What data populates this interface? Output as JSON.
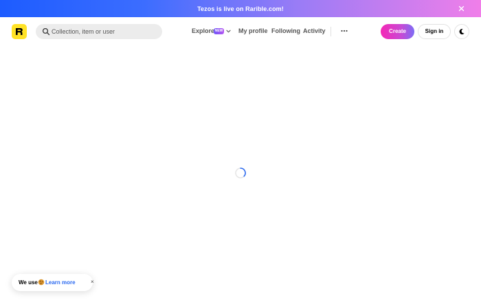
{
  "banner": {
    "text": "Tezos is live on Rarible.com!",
    "close_icon": "close-icon"
  },
  "header": {
    "logo_icon": "rarible-logo",
    "search": {
      "placeholder": "Collection, item or user",
      "icon": "search-icon"
    },
    "nav": {
      "explore": "Explore",
      "explore_badge": "NEW",
      "my_profile": "My profile",
      "following": "Following",
      "activity": "Activity",
      "more_icon": "more-icon"
    },
    "create_label": "Create",
    "sign_in_label": "Sign in",
    "theme_icon": "moon-icon"
  },
  "cookie": {
    "text": "We use",
    "emoji_icon": "cookie-icon",
    "link": "Learn more",
    "close": "×"
  },
  "colors": {
    "banner_gradient": [
      "#1d5cff",
      "#9a7cf6",
      "#f07ee9"
    ],
    "logo_bg": "#ffe226",
    "create_gradient": [
      "#f527b5",
      "#7c6cf5"
    ],
    "link": "#2d6bf0",
    "spinner": "#2d6bf0"
  }
}
